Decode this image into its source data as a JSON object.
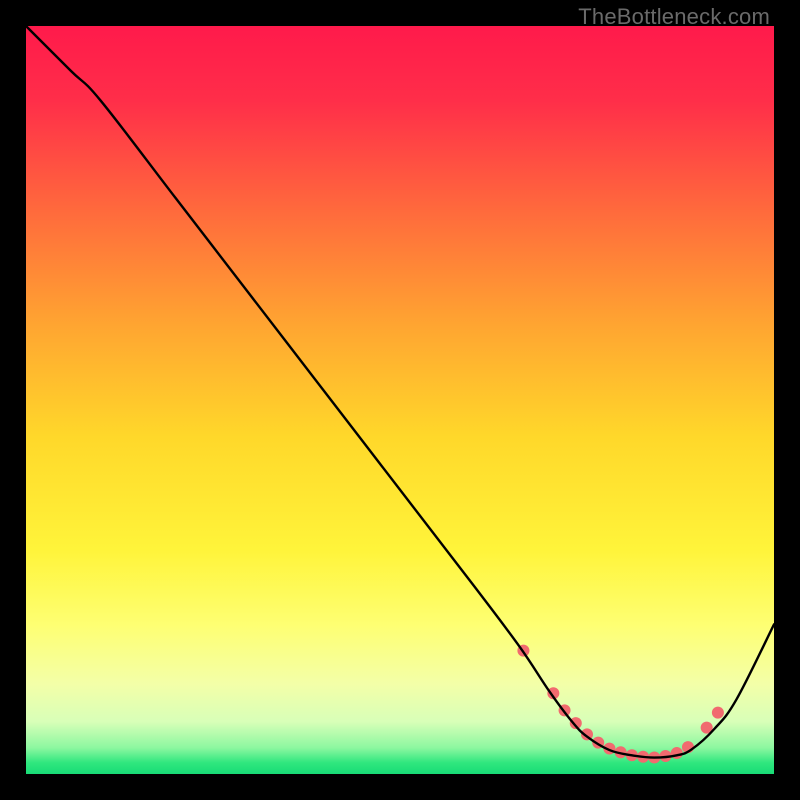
{
  "watermark": "TheBottleneck.com",
  "chart_data": {
    "type": "line",
    "title": "",
    "xlabel": "",
    "ylabel": "",
    "xlim": [
      0,
      100
    ],
    "ylim": [
      0,
      100
    ],
    "background_gradient": {
      "stops": [
        {
          "offset": 0.0,
          "color": "#ff1a4b"
        },
        {
          "offset": 0.1,
          "color": "#ff2e49"
        },
        {
          "offset": 0.25,
          "color": "#ff6b3c"
        },
        {
          "offset": 0.4,
          "color": "#ffa531"
        },
        {
          "offset": 0.55,
          "color": "#ffd82a"
        },
        {
          "offset": 0.7,
          "color": "#fff43a"
        },
        {
          "offset": 0.8,
          "color": "#feff72"
        },
        {
          "offset": 0.88,
          "color": "#f3ffa8"
        },
        {
          "offset": 0.93,
          "color": "#d8ffb8"
        },
        {
          "offset": 0.965,
          "color": "#8cf7a0"
        },
        {
          "offset": 0.985,
          "color": "#2fe77e"
        },
        {
          "offset": 1.0,
          "color": "#18db76"
        }
      ]
    },
    "series": [
      {
        "name": "curve",
        "color": "#000000",
        "x": [
          0,
          6,
          10,
          20,
          30,
          40,
          50,
          60,
          66,
          70,
          73,
          75,
          78,
          81,
          84,
          87,
          89,
          92,
          95,
          100
        ],
        "y": [
          100,
          94,
          90,
          77,
          64,
          51,
          38,
          25,
          17,
          11,
          7,
          5,
          3.2,
          2.5,
          2.2,
          2.5,
          3.3,
          6,
          10,
          20
        ]
      }
    ],
    "markers": {
      "name": "dots",
      "color": "#f16a6f",
      "radius": 6,
      "x": [
        66.5,
        70.5,
        72,
        73.5,
        75,
        76.5,
        78,
        79.5,
        81,
        82.5,
        84,
        85.5,
        87,
        88.5,
        91,
        92.5
      ],
      "y": [
        16.5,
        10.8,
        8.5,
        6.8,
        5.3,
        4.2,
        3.4,
        2.9,
        2.5,
        2.3,
        2.2,
        2.4,
        2.8,
        3.6,
        6.2,
        8.2
      ]
    }
  }
}
